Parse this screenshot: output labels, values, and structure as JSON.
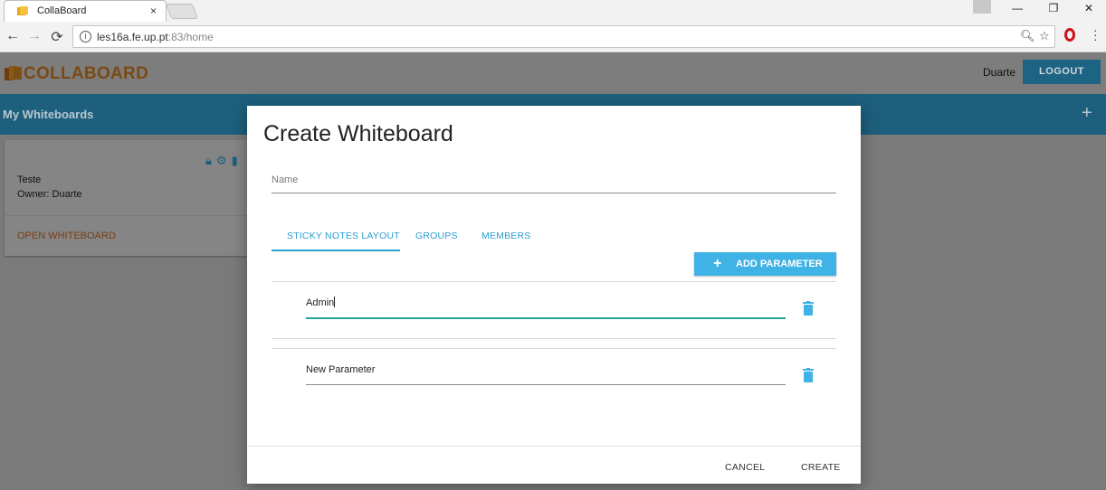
{
  "browser": {
    "tab_title": "CollaBoard",
    "tab_close": "×",
    "url_host": "les16a.fe.up.pt",
    "url_path": ":83/home",
    "nav": {
      "back": "←",
      "forward": "→",
      "reload": "⟳"
    },
    "window_controls": {
      "minimize": "—",
      "restore": "❐",
      "close": "✕"
    },
    "omni_icons": {
      "search": "🔍︎",
      "star": "☆"
    }
  },
  "header": {
    "logo_text": "COLLABOARD",
    "user_name": "Duarte",
    "logout_label": "LOGOUT"
  },
  "subbar": {
    "title": "My Whiteboards",
    "add": "+"
  },
  "board_card": {
    "icons": [
      "🔒︎",
      "⚙︎",
      "▮"
    ],
    "title": "Teste",
    "owner": "Owner: Duarte",
    "open_label": "OPEN WHITEBOARD"
  },
  "modal": {
    "title": "Create Whiteboard",
    "name_placeholder": "Name",
    "tabs": [
      {
        "label": "STICKY NOTES LAYOUT",
        "active": true
      },
      {
        "label": "GROUPS",
        "active": false
      },
      {
        "label": "MEMBERS",
        "active": false
      }
    ],
    "add_parameter_plus": "+",
    "add_parameter_label": "ADD PARAMETER",
    "parameters": [
      {
        "value": "Admin",
        "focused": true
      },
      {
        "value": "New Parameter",
        "focused": false
      }
    ],
    "cancel_label": "CANCEL",
    "create_label": "CREATE"
  },
  "colors": {
    "accent": "#3fb2e6",
    "focus_underline": "#26a69a",
    "logo": "#d9801d"
  }
}
